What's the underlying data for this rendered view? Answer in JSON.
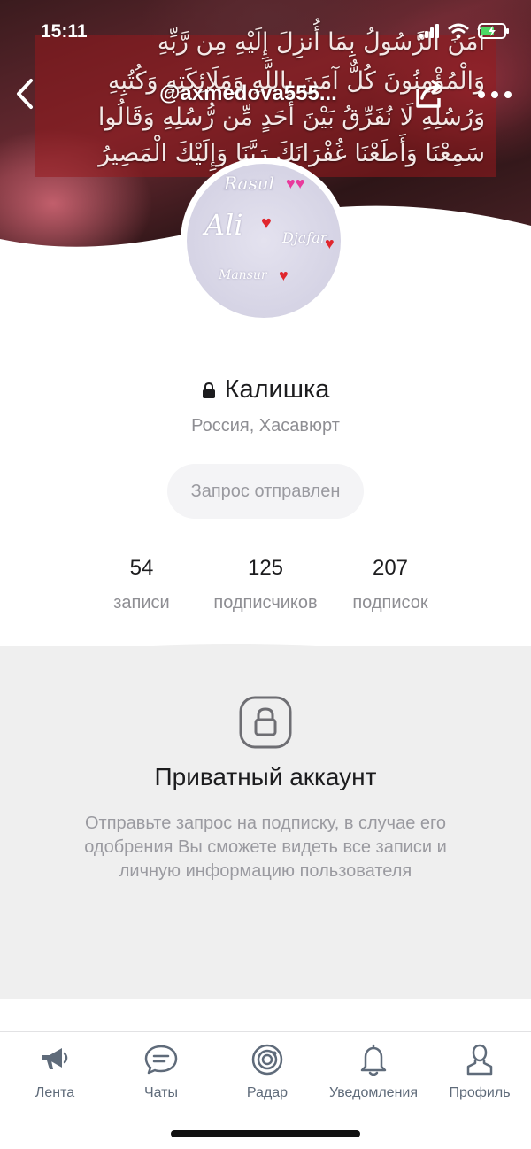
{
  "status_bar": {
    "time": "15:11"
  },
  "cover": {
    "arabic_lines": [
      "آمَنَ الرَّسُولُ بِمَا أُنزِلَ إِلَيْهِ مِن رَّبِّهِ",
      "وَالْمُؤْمِنُونَ كُلٌّ آمَنَ بِاللَّهِ وَمَلَائِكَتِهِ وَكُتُبِهِ",
      "وَرُسُلِهِ لَا نُفَرِّقُ بَيْنَ أَحَدٍ مِّن رُّسُلِهِ وَقَالُوا",
      "سَمِعْنَا وَأَطَعْنَا غُفْرَانَكَ رَبَّنَا وَإِلَيْكَ الْمَصِيرُ"
    ]
  },
  "nav": {
    "handle": "@axmedova555...",
    "back_icon": "chevron-left-icon",
    "share_icon": "share-icon",
    "more_icon": "more-icon"
  },
  "avatar": {
    "script_words": [
      "Rasul",
      "Ali",
      "Djafar",
      "Mansur"
    ]
  },
  "profile": {
    "name": "Калишка",
    "location": "Россия, Хасавюрт",
    "request_button": "Запрос отправлен"
  },
  "stats": [
    {
      "value": "54",
      "label": "записи"
    },
    {
      "value": "125",
      "label": "подписчиков"
    },
    {
      "value": "207",
      "label": "подписок"
    }
  ],
  "private": {
    "title": "Приватный аккаунт",
    "description": "Отправьте запрос на подписку, в случае его одобрения Вы сможете видеть все записи и личную информацию пользователя"
  },
  "tabs": [
    {
      "label": "Лента",
      "icon": "megaphone-icon"
    },
    {
      "label": "Чаты",
      "icon": "chat-bubble-icon"
    },
    {
      "label": "Радар",
      "icon": "radar-icon"
    },
    {
      "label": "Уведомления",
      "icon": "bell-icon"
    },
    {
      "label": "Профиль",
      "icon": "person-icon"
    }
  ],
  "colors": {
    "cover_band": "#961e24",
    "text_muted": "#8e8e93",
    "tab_icon": "#5f6b7a",
    "private_bg": "#efefef"
  }
}
